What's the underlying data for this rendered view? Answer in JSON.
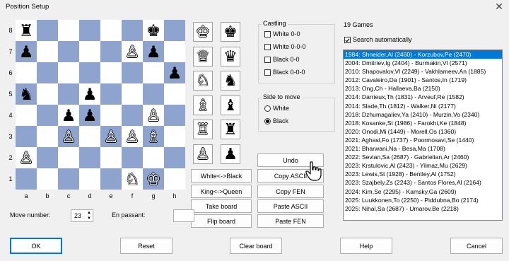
{
  "window": {
    "title": "Position Setup",
    "close_glyph": "✕"
  },
  "board": {
    "ranks": [
      "8",
      "7",
      "6",
      "5",
      "4",
      "3",
      "2",
      "1"
    ],
    "files": [
      "a",
      "b",
      "c",
      "d",
      "e",
      "f",
      "g",
      "h"
    ],
    "pieces": [
      [
        "♜",
        "",
        "",
        "",
        "",
        "",
        "♚",
        ""
      ],
      [
        "♟",
        "",
        "",
        "",
        "",
        "♙",
        "♟",
        ""
      ],
      [
        "",
        "",
        "",
        "",
        "",
        "",
        "",
        "♟"
      ],
      [
        "♞",
        "",
        "",
        "♟",
        "",
        "",
        "",
        ""
      ],
      [
        "",
        "",
        "♟",
        "♟",
        "",
        "",
        "♙",
        ""
      ],
      [
        "",
        "",
        "♙",
        "",
        "♙",
        "♙",
        "♗",
        ""
      ],
      [
        "♙",
        "",
        "",
        "",
        "",
        "",
        "",
        ""
      ],
      [
        "",
        "",
        "",
        "",
        "",
        "♘",
        "♔",
        ""
      ]
    ],
    "colors": [
      [
        "b",
        "",
        "",
        "",
        "",
        "",
        "b",
        ""
      ],
      [
        "b",
        "",
        "",
        "",
        "",
        "w",
        "b",
        ""
      ],
      [
        "",
        "",
        "",
        "",
        "",
        "",
        "",
        "b"
      ],
      [
        "b",
        "",
        "",
        "b",
        "",
        "",
        "",
        ""
      ],
      [
        "",
        "",
        "b",
        "b",
        "",
        "",
        "w",
        ""
      ],
      [
        "",
        "",
        "w",
        "",
        "w",
        "w",
        "w",
        ""
      ],
      [
        "w",
        "",
        "",
        "",
        "",
        "",
        "",
        ""
      ],
      [
        "",
        "",
        "",
        "",
        "",
        "w",
        "w",
        ""
      ]
    ]
  },
  "palette": {
    "white": [
      "♔",
      "♕",
      "♘",
      "♗",
      "♖",
      "♙"
    ],
    "black": [
      "♚",
      "♛",
      "♞",
      "♝",
      "♜",
      "♟"
    ]
  },
  "buttons": {
    "swap_colors": "White<->Black",
    "king_queen": "King<->Queen",
    "take_board": "Take board",
    "flip_board": "Flip board",
    "undo": "Undo",
    "copy_ascii": "Copy ASCII",
    "copy_fen": "Copy FEN",
    "paste_ascii": "Paste ASCII",
    "paste_fen": "Paste FEN",
    "ok": "OK",
    "reset": "Reset",
    "clear_board": "Clear board",
    "help": "Help",
    "cancel": "Cancel"
  },
  "castling": {
    "label": "Castling",
    "options": [
      "White 0-0",
      "White 0-0-0",
      "Black 0-0",
      "Black 0-0-0"
    ],
    "checked": [
      false,
      false,
      false,
      false
    ]
  },
  "side_to_move": {
    "label": "Side to move",
    "options": [
      "White",
      "Black"
    ],
    "selected": "Black"
  },
  "games": {
    "count_label": "19 Games",
    "search_auto_label": "Search automatically",
    "search_auto_checked": true,
    "items": [
      "1984: Shneider,Al (2460) - Korzubov,Pe (2470)",
      "2004: Dmitriev,Ig (2404) - Burmakin,Vl (2571)",
      "2010: Shapovalov,Vl (2249) - Vakhlameev,An (1885)",
      "2012: Cavaleiro,Da (1901) - Santos,In (1719)",
      "2013: Ong,Ch - Hallaeva,Ba (2150)",
      "2014: Darrieux,Th (1831) - Arveuf,Re (1582)",
      "2014: Slade,Th (1812) - Walker,Ni (2177)",
      "2018: Dzhumagaliev,Ya (2410) - Murzin,Vo (2340)",
      "2018: Kosanke,St (1986) - Farokhi,Ke (1848)",
      "2020: Onodi,Mi (1449) - Morell,Os (1360)",
      "2021: Aghasi,Fo (1737) - Poormosavi,Se (1440)",
      "2021: Bharwani,Na - Besa,Ma (1708)",
      "2022: Sevian,Sa (2687) - Gabrielian,Ar (2460)",
      "2023: Krstulovic,Al (2423) - Yilmaz,Mu (2629)",
      "2023: Lewis,St (1928) - Bentley,Al (1752)",
      "2023: Szajbely,Zs (2243) - Santos Flores,Al (2164)",
      "2024: Kim,Se (2295) - Kamsky,Ga (2609)",
      "2025: Luukkonen,To (2250) - Piddubna,Bo (2174)",
      "2025: Nihal,Sa (2687) - Umarov,Be (2218)"
    ],
    "selected_index": 0
  },
  "move_number": {
    "label": "Move number:",
    "value": "23"
  },
  "en_passant": {
    "label": "En passant:",
    "value": ""
  },
  "colors": {
    "board_dark": "#8ea4cf",
    "board_light": "#ffffff",
    "selection": "#0078d7"
  },
  "icons": {
    "cursor": "hand-pointer-icon"
  }
}
